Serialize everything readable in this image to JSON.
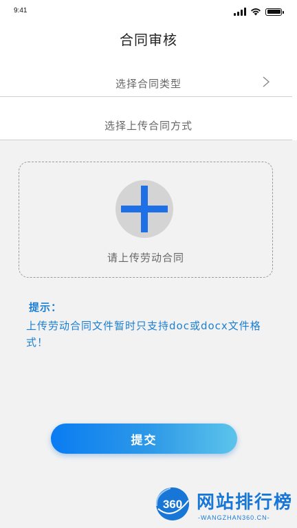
{
  "status_bar": {
    "time": "9:41"
  },
  "header": {
    "title": "合同审核"
  },
  "form": {
    "contract_type_placeholder": "选择合同类型",
    "upload_method_placeholder": "选择上传合同方式"
  },
  "upload": {
    "label": "请上传劳动合同"
  },
  "tips": {
    "title": "提示：",
    "body": "上传劳动合同文件暂时只支持doc或docx文件格式！"
  },
  "actions": {
    "submit_label": "提交"
  },
  "watermark": {
    "title": "网站排行榜",
    "subtitle": "-WANGZHAN360.CN-",
    "logo_text": "360"
  },
  "colors": {
    "accent": "#1f6fe6",
    "tip_text": "#1a7fd4",
    "button_start": "#0a7cf2",
    "button_end": "#5cc4ea"
  },
  "icons": {
    "chevron": "chevron-right-icon",
    "upload": "plus-icon",
    "signal": "signal-icon",
    "wifi": "wifi-icon",
    "battery": "battery-icon"
  }
}
